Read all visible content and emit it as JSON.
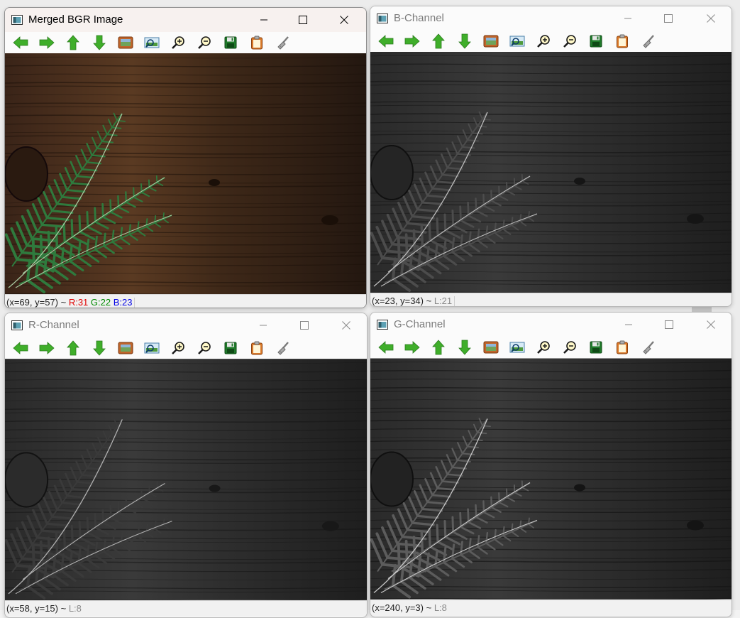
{
  "windows": {
    "merged": {
      "title": "Merged BGR Image",
      "status": {
        "coord": "(x=69, y=57) ~",
        "r": "R:31",
        "g": "G:22",
        "b": "B:23"
      }
    },
    "b_channel": {
      "title": "B-Channel",
      "status": {
        "coord": "(x=23, y=34) ~",
        "l": "L:21"
      }
    },
    "r_channel": {
      "title": "R-Channel",
      "status": {
        "coord": "(x=58, y=15) ~",
        "l": "L:8"
      }
    },
    "g_channel": {
      "title": "G-Channel",
      "status": {
        "coord": "(x=240, y=3) ~",
        "l": "L:8"
      }
    }
  },
  "toolbar": {
    "buttons": [
      "pan-left-icon",
      "pan-right-icon",
      "pan-up-icon",
      "pan-down-icon",
      "zoom-fit-icon",
      "zoom-image-icon",
      "zoom-in-icon",
      "zoom-out-icon",
      "save-icon",
      "properties-icon",
      "clear-icon"
    ]
  },
  "caption_buttons": [
    "minimize-icon",
    "maximize-icon",
    "close-icon"
  ],
  "colors": {
    "arrow_green": "#3fae2a",
    "status_r": "#e00000",
    "status_g": "#008a00",
    "status_b": "#0000e6",
    "wood_dark": "#2b1b12",
    "fern_green": "#2f7a3d"
  }
}
